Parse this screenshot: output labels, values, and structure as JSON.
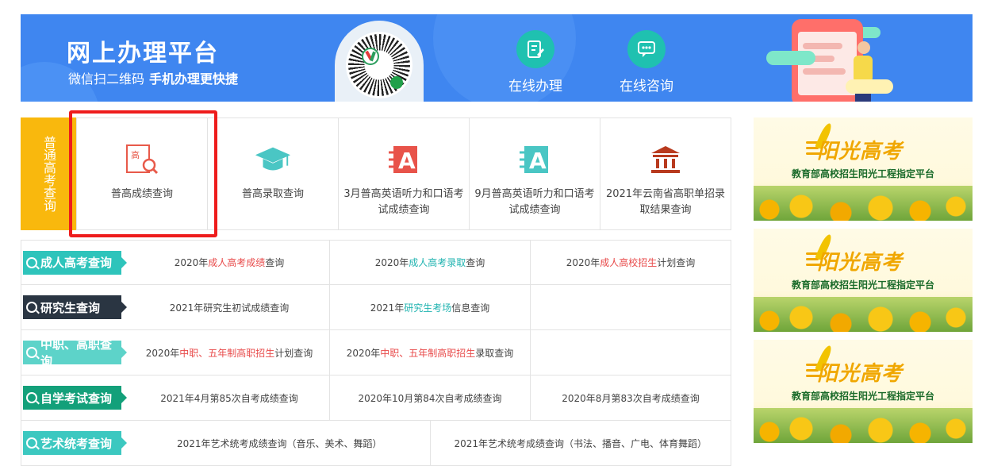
{
  "banner": {
    "title": "网上办理平台",
    "subtitle_prefix": "微信扫二维码",
    "subtitle_strong": "手机办理更快捷",
    "buttons": [
      {
        "label": "在线办理",
        "icon": "edit-document-icon"
      },
      {
        "label": "在线咨询",
        "icon": "chat-icon"
      }
    ]
  },
  "putong": {
    "label": "普通高考查询",
    "cards": [
      {
        "label": "普高成绩查询",
        "icon": "score-search-icon"
      },
      {
        "label": "普高录取查询",
        "icon": "graduation-cap-icon"
      },
      {
        "label": "3月普高英语听力和口语考试成绩查询",
        "icon": "letter-a-icon"
      },
      {
        "label": "9月普高英语听力和口语考试成绩查询",
        "icon": "letter-a-icon"
      },
      {
        "label": "2021年云南省高职单招录取结果查询",
        "icon": "building-icon"
      }
    ]
  },
  "rows": [
    {
      "tag": "成人高考查询",
      "color": "#2ec4bb",
      "cells": [
        {
          "pre": "2020年",
          "hl": "成人高考成绩",
          "post": "查询",
          "hl_color": "red"
        },
        {
          "pre": "2020年",
          "hl": "成人高考录取",
          "post": "查询",
          "hl_color": "teal"
        },
        {
          "pre": "2020年",
          "hl": "成人高校招生",
          "post": "计划查询",
          "hl_color": "red"
        }
      ]
    },
    {
      "tag": "研究生查询",
      "color": "#2a3542",
      "cells": [
        {
          "pre": "2021年研究生初试成绩查询",
          "hl": "",
          "post": "",
          "hl_color": ""
        },
        {
          "pre": "2021年",
          "hl": "研究生考场",
          "post": "信息查询",
          "hl_color": "teal"
        },
        {
          "pre": "",
          "hl": "",
          "post": "",
          "hl_color": ""
        }
      ]
    },
    {
      "tag": "中职、高职查询",
      "color": "#5dd3c9",
      "cells": [
        {
          "pre": "2020年",
          "hl": "中职、五年制高职招生",
          "post": "计划查询",
          "hl_color": "red"
        },
        {
          "pre": "2020年",
          "hl": "中职、五年制高职招生",
          "post": "录取查询",
          "hl_color": "red"
        },
        {
          "pre": "",
          "hl": "",
          "post": "",
          "hl_color": ""
        }
      ]
    },
    {
      "tag": "自学考试查询",
      "color": "#13a07a",
      "cells": [
        {
          "pre": "2021年4月第85次自考成绩查询",
          "hl": "",
          "post": "",
          "hl_color": ""
        },
        {
          "pre": "2020年10月第84次自考成绩查询",
          "hl": "",
          "post": "",
          "hl_color": ""
        },
        {
          "pre": "2020年8月第83次自考成绩查询",
          "hl": "",
          "post": "",
          "hl_color": ""
        }
      ]
    },
    {
      "tag": "艺术统考查询",
      "color": "#3cc8c0",
      "cells": [
        {
          "pre": "2021年艺术统考成绩查询（音乐、美术、舞蹈）",
          "hl": "",
          "post": "",
          "hl_color": ""
        },
        {
          "pre": "2021年艺术统考成绩查询（书法、播音、广电、体育舞蹈）",
          "hl": "",
          "post": "",
          "hl_color": ""
        }
      ]
    }
  ],
  "ads": [
    {
      "title": "阳光高考",
      "sub": "教育部高校招生阳光工程指定平台"
    },
    {
      "title": "阳光高考",
      "sub": "教育部高校招生阳光工程指定平台"
    },
    {
      "title": "阳光高考",
      "sub": "教育部高校招生阳光工程指定平台"
    }
  ]
}
